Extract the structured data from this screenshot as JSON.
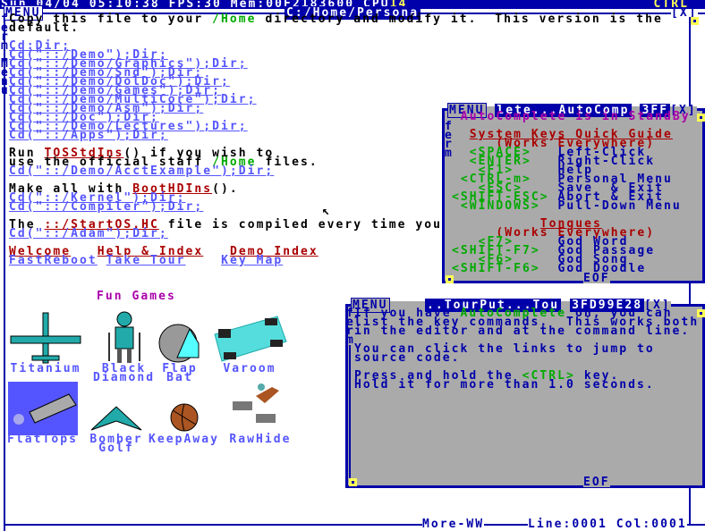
{
  "topbar": {
    "status": "Sun 04/04 05:10:38 FPS:30 Mem:00F2183600 CPU",
    "cpu": "14",
    "ctrl": "CTRL"
  },
  "main": {
    "menu": "MENU",
    "title": "C:/Home/Persona",
    "close": "[X]",
    "side": [
      "f",
      "e",
      "r",
      "m",
      "|",
      "M",
      "e",
      "n",
      "u"
    ],
    "lines": [
      [
        {
          "t": "Copy this file to your ",
          "c": "k"
        },
        {
          "t": "/Home",
          "c": "gr"
        },
        {
          "t": " directory and modify it.  This version is the",
          "c": "k"
        }
      ],
      [
        {
          "t": "default.",
          "c": "k"
        }
      ],
      [],
      [
        {
          "t": "Cd:Dir;",
          "c": "lk"
        }
      ],
      [
        {
          "t": "Cd(\"::/Demo\");Dir;",
          "c": "lk"
        }
      ],
      [
        {
          "t": "Cd(\"::/Demo/Graphics\");Dir;",
          "c": "lk"
        }
      ],
      [
        {
          "t": "Cd(\"::/Demo/Snd\");Dir;",
          "c": "lk"
        }
      ],
      [
        {
          "t": "Cd(\"::/Demo/DolDoc\");Dir;",
          "c": "lk"
        }
      ],
      [
        {
          "t": "Cd(\"::/Demo/Games\");Dir;",
          "c": "lk"
        }
      ],
      [
        {
          "t": "Cd(\"::/Demo/MultiCore\");Dir;",
          "c": "lk"
        }
      ],
      [
        {
          "t": "Cd(\"::/Demo/Asm\");Dir;",
          "c": "lk"
        }
      ],
      [
        {
          "t": "Cd(\"::/Doc\");Dir;",
          "c": "lk"
        }
      ],
      [
        {
          "t": "Cd(\"::/Demo/Lectures\");Dir;",
          "c": "lk"
        }
      ],
      [
        {
          "t": "Cd(\"::/Apps\");Dir;",
          "c": "lk"
        }
      ],
      [],
      [
        {
          "t": "Run ",
          "c": "k"
        },
        {
          "t": "TOSStdIns",
          "c": "rd"
        },
        {
          "t": "() if you wish to",
          "c": "k"
        }
      ],
      [
        {
          "t": "use the official staff ",
          "c": "k"
        },
        {
          "t": "/Home",
          "c": "gr"
        },
        {
          "t": " files.",
          "c": "k"
        }
      ],
      [
        {
          "t": "Cd(\"::/Demo/AcctExample\");Dir;",
          "c": "lk"
        }
      ],
      [],
      [
        {
          "t": "Make all with ",
          "c": "k"
        },
        {
          "t": "BootHDIns",
          "c": "rd"
        },
        {
          "t": "().",
          "c": "k"
        }
      ],
      [
        {
          "t": "Cd(\"::/Kernel\");Dir;",
          "c": "lk"
        }
      ],
      [
        {
          "t": "Cd(\"::/Compiler\");Dir;",
          "c": "lk"
        }
      ],
      [],
      [
        {
          "t": "The ",
          "c": "k"
        },
        {
          "t": "::/StartOS.HC",
          "c": "rd"
        },
        {
          "t": " file is compiled every time you",
          "c": "k"
        }
      ],
      [
        {
          "t": "Cd(\"::/Adam\");Dir;",
          "c": "lk"
        }
      ],
      [],
      [
        {
          "t": "Welcome",
          "c": "rd"
        },
        {
          "t": "   ",
          "c": "k"
        },
        {
          "t": "Help & Index",
          "c": "rd"
        },
        {
          "t": "   ",
          "c": "k"
        },
        {
          "t": "Demo Index",
          "c": "rd"
        }
      ],
      [
        {
          "t": "FastReboot",
          "c": "lk"
        },
        {
          "t": " ",
          "c": "k"
        },
        {
          "t": "Take Tour",
          "c": "lk"
        },
        {
          "t": "    ",
          "c": "k"
        },
        {
          "t": "Key Map",
          "c": "lk"
        }
      ]
    ],
    "games_title": "Fun Games",
    "games": [
      [
        "Titanium"
      ],
      [
        "Black",
        "Diamond"
      ],
      [
        "Flap",
        "Bat"
      ],
      [
        "Varoom"
      ],
      [
        "FlatTops"
      ],
      [
        "Bomber",
        "Golf"
      ],
      [
        "KeepAway"
      ],
      [
        "RawHide"
      ]
    ],
    "status_more": "More-WW",
    "status_pos": "Line:0001 Col:0001"
  },
  "auto": {
    "menu": "MENU",
    "title": "lete...AutoComp",
    "id": "3FF",
    "close": "[X]",
    "side": [
      "f",
      "e",
      "r",
      "m"
    ],
    "eof": "EOF",
    "lines": [
      [
        {
          "t": " AutoComplete is in StandBy",
          "c": "pu"
        }
      ],
      [],
      [
        {
          "t": "  ",
          "c": "k"
        },
        {
          "t": "System Keys Quick Guide",
          "c": "rd"
        }
      ],
      [
        {
          "t": "     (Works Everywhere)",
          "c": "rt"
        }
      ],
      [
        {
          "t": "  <SPACE>   ",
          "c": "gr"
        },
        {
          "t": "Left-Click",
          "c": "bl"
        }
      ],
      [
        {
          "t": "  <ENTER>   ",
          "c": "gr"
        },
        {
          "t": "Right-Click",
          "c": "bl"
        }
      ],
      [
        {
          "t": "   <F1>     ",
          "c": "gr"
        },
        {
          "t": "Help",
          "c": "bl"
        }
      ],
      [
        {
          "t": " <CTRL-m>   ",
          "c": "gr"
        },
        {
          "t": "Personal Menu",
          "c": "bl"
        }
      ],
      [
        {
          "t": "   <ESC>    ",
          "c": "gr"
        },
        {
          "t": "Save  & Exit",
          "c": "bl"
        }
      ],
      [
        {
          "t": "<SHIFT-ESC> ",
          "c": "gr"
        },
        {
          "t": "Abort & Exit",
          "c": "bl"
        }
      ],
      [
        {
          "t": " <WINDOWS>  ",
          "c": "gr"
        },
        {
          "t": "Pull-Down Menu",
          "c": "bl"
        }
      ],
      [],
      [
        {
          "t": "          ",
          "c": "k"
        },
        {
          "t": "Tongues",
          "c": "rd"
        }
      ],
      [
        {
          "t": "     (Works Everywhere)",
          "c": "rt"
        }
      ],
      [
        {
          "t": "   <F7>     ",
          "c": "gr"
        },
        {
          "t": "God Word",
          "c": "bl"
        }
      ],
      [
        {
          "t": "<SHIFT-F7>  ",
          "c": "gr"
        },
        {
          "t": "God Passage",
          "c": "bl"
        }
      ],
      [
        {
          "t": "   <F6>     ",
          "c": "gr"
        },
        {
          "t": "God Song",
          "c": "bl"
        }
      ],
      [
        {
          "t": "<SHIFT-F6>  ",
          "c": "gr"
        },
        {
          "t": "God Doodle",
          "c": "bl"
        }
      ]
    ]
  },
  "tour": {
    "menu": "MENU",
    "title": "..TourPut...Tou",
    "id": "3FD99E28",
    "close": "[X]",
    "side": [
      "f",
      "e",
      "r",
      "m"
    ],
    "eof": "EOF",
    "lines": [
      [
        {
          "t": "If you have ",
          "c": "bl"
        },
        {
          "t": "AutoComplete",
          "c": "gr"
        },
        {
          "t": " on, you can",
          "c": "bl"
        }
      ],
      [
        {
          "t": "list the key commands.  This works both",
          "c": "bl"
        }
      ],
      [
        {
          "t": "in the editor and at the command line.",
          "c": "bl"
        }
      ],
      [],
      [
        {
          "t": "You can click the links to jump to",
          "c": "bl"
        }
      ],
      [
        {
          "t": "source code.",
          "c": "bl"
        }
      ],
      [],
      [
        {
          "t": "Press and hold the ",
          "c": "bl"
        },
        {
          "t": "<CTRL>",
          "c": "gr"
        },
        {
          "t": " key.",
          "c": "bl"
        }
      ],
      [
        {
          "t": "Hold it for more than 1.0 seconds.",
          "c": "bl"
        }
      ]
    ]
  },
  "colors": {
    "blue": "#0000aa",
    "link": "#5555ff",
    "red": "#aa0000",
    "green": "#00aa00",
    "purple": "#aa00aa",
    "yellow": "#ffff55",
    "grey": "#aaaaaa"
  }
}
